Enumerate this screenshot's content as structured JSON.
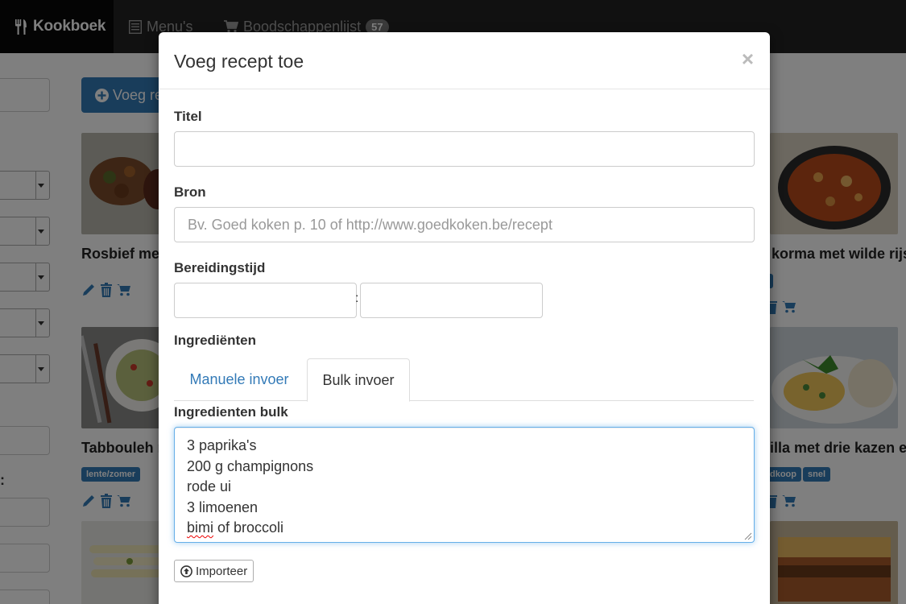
{
  "navbar": {
    "brand": "Kookboek",
    "menus_label": "Menu's",
    "shopping_label": "Boodschappenlijst",
    "shopping_count": "57"
  },
  "background": {
    "add_button_label": "Voeg re",
    "colon_label": ":",
    "cards": [
      {
        "title": "Rosbief met",
        "tags": []
      },
      {
        "title": "korma met wilde rijst",
        "tags": []
      },
      {
        "title": "Tabbouleh r",
        "tags": [
          "lente/zomer"
        ]
      },
      {
        "title": "illa met drie kazen en",
        "tags": [
          "dkoop",
          "snel"
        ]
      }
    ]
  },
  "modal": {
    "title": "Voeg recept toe",
    "close_symbol": "×",
    "fields": {
      "title_label": "Titel",
      "title_value": "",
      "source_label": "Bron",
      "source_placeholder": "Bv. Goed koken p. 10 of http://www.goedkoken.be/recept",
      "prep_time_label": "Bereidingstijd",
      "prep_time_separator": ":",
      "ingredients_label": "Ingrediënten"
    },
    "tabs": [
      {
        "label": "Manuele invoer",
        "active": false
      },
      {
        "label": "Bulk invoer",
        "active": true
      }
    ],
    "bulk_label": "Ingredienten bulk",
    "bulk_lines": [
      "3 paprika's",
      "200 g champignons",
      "rode ui",
      "3 limoenen",
      "bimi of broccoli"
    ],
    "bulk_misspelled_word": "bimi",
    "bulk_last_line_rest": " of broccoli",
    "import_button_label": "Importeer"
  },
  "colors": {
    "navbar_bg": "#222222",
    "primary": "#337ab7",
    "focus_border": "#66afe9",
    "backdrop": "rgba(0,0,0,0.5)"
  },
  "icons": {
    "brand": "cutlery-icon",
    "menus": "list-icon",
    "shopping": "cart-icon",
    "add": "plus-circle-icon",
    "import": "upload-circle-icon",
    "card_actions": [
      "pencil-icon",
      "trash-icon",
      "cart-icon"
    ]
  }
}
